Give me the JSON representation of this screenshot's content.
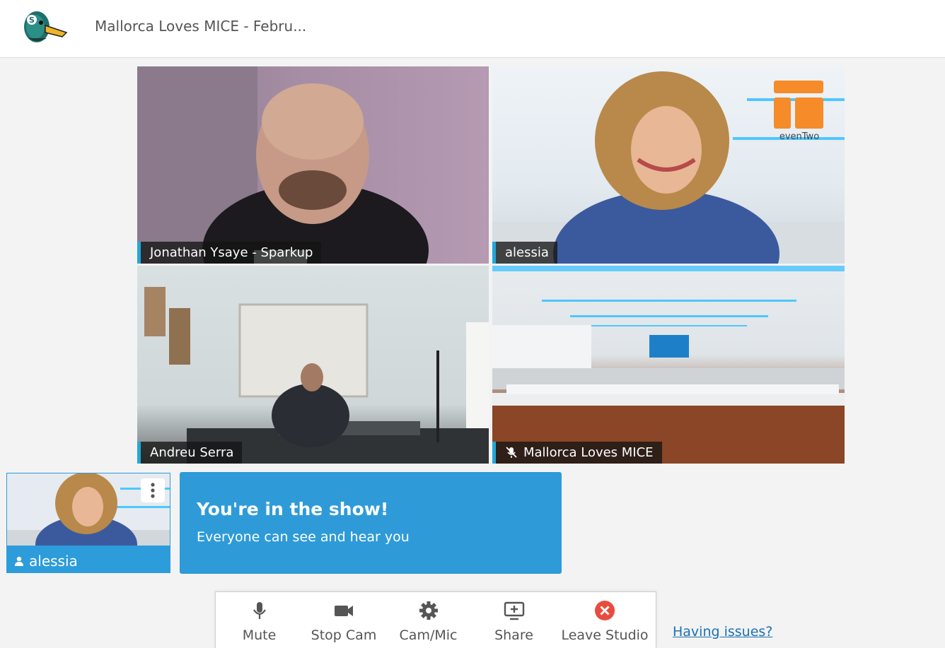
{
  "header": {
    "event_title": "Mallorca Loves MICE - Febru..."
  },
  "stage": {
    "tiles": [
      {
        "name": "Jonathan Ysaye - Sparkup",
        "muted": false
      },
      {
        "name": "alessia",
        "muted": false
      },
      {
        "name": "Andreu Serra",
        "muted": false
      },
      {
        "name": "Mallorca Loves MICE",
        "muted": true
      }
    ]
  },
  "brand_overlay": {
    "text": "evenTwo"
  },
  "self_view": {
    "name": "alessia",
    "icon": "person-icon"
  },
  "status_card": {
    "title": "You're in the show!",
    "subtitle": "Everyone can see and hear you"
  },
  "toolbar": {
    "mute_label": "Mute",
    "stop_cam_label": "Stop Cam",
    "cam_mic_label": "Cam/Mic",
    "share_label": "Share",
    "leave_label": "Leave Studio"
  },
  "help_link": "Having issues?",
  "colors": {
    "accent": "#2e9bd8",
    "leave_red": "#e84c3d",
    "brand_orange": "#f68b29"
  }
}
